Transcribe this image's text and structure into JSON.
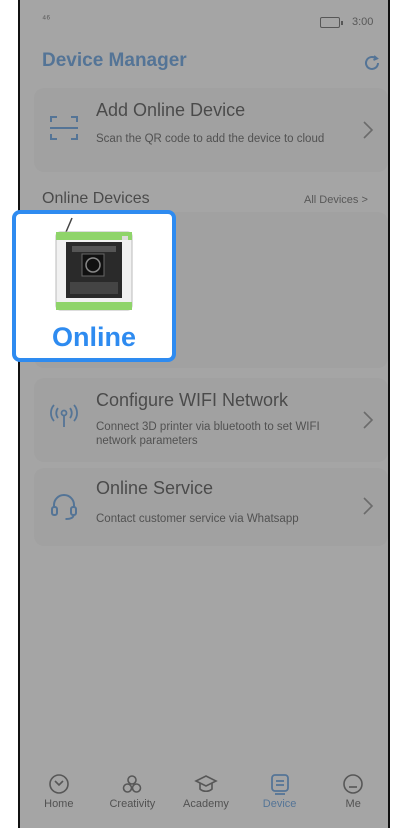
{
  "status_bar": {
    "signal": "⁴⁶",
    "time": "3:00"
  },
  "header": {
    "title": "Device Manager",
    "refresh_icon": "refresh-icon"
  },
  "add_device": {
    "title": "Add Online Device",
    "description": "Scan the QR code to add the device to cloud",
    "icon": "scan-icon"
  },
  "online_devices": {
    "title": "Online Devices",
    "all_link": "All Devices >",
    "devices": [
      {
        "status": "Online",
        "icon": "printer-icon"
      }
    ]
  },
  "configure_wifi": {
    "title": "Configure WIFI Network",
    "description": "Connect 3D printer via bluetooth to set WIFI network parameters",
    "icon": "wifi-signal-icon"
  },
  "online_service": {
    "title": "Online Service",
    "description": "Contact customer service via Whatsapp",
    "icon": "headset-icon"
  },
  "bottom_nav": [
    {
      "label": "Home",
      "icon": "home-icon",
      "active": false
    },
    {
      "label": "Creativity",
      "icon": "creativity-icon",
      "active": false
    },
    {
      "label": "Academy",
      "icon": "academy-icon",
      "active": false
    },
    {
      "label": "Device",
      "icon": "device-icon",
      "active": true
    },
    {
      "label": "Me",
      "icon": "me-icon",
      "active": false
    }
  ],
  "colors": {
    "accent": "#2b7fd8",
    "highlight": "#2e8bf0",
    "card": "#f4f4f4"
  }
}
